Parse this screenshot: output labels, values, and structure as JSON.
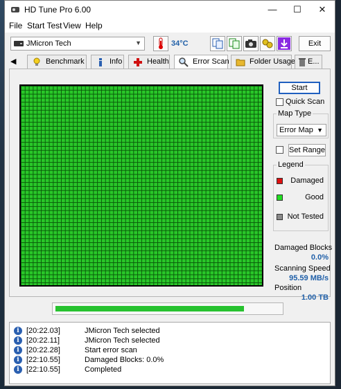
{
  "window": {
    "title": "HD Tune Pro 6.00",
    "controls": {
      "minimize": "—",
      "maximize": "☐",
      "close": "✕"
    }
  },
  "menu": [
    "File",
    "Start Test",
    "View",
    "Help"
  ],
  "toolbar": {
    "drive": "JMicron Tech",
    "temperature": "34°C",
    "exit_label": "Exit",
    "icons": [
      "copy-info-icon",
      "copy-text-icon",
      "screenshot-icon",
      "options-icon",
      "save-icon"
    ]
  },
  "tabs": {
    "scroll_left": "◀",
    "items": [
      {
        "label": "Benchmark",
        "icon": "lightbulb-icon"
      },
      {
        "label": "Info",
        "icon": "info-icon"
      },
      {
        "label": "Health",
        "icon": "health-cross-icon"
      },
      {
        "label": "Error Scan",
        "icon": "magnifier-icon",
        "active": true
      },
      {
        "label": "Folder Usage",
        "icon": "folder-icon"
      },
      {
        "label": "E...",
        "icon": "trash-icon"
      }
    ]
  },
  "error_scan": {
    "start_label": "Start",
    "quick_scan_label": "Quick Scan",
    "quick_scan_checked": false,
    "map_type_title": "Map Type",
    "map_type_value": "Error Map",
    "set_range_label": "Set Range",
    "set_range_checked": false,
    "legend_title": "Legend",
    "legend": [
      {
        "label": "Damaged",
        "color": "#e01010"
      },
      {
        "label": "Good",
        "color": "#22dd22"
      },
      {
        "label": "Not Tested",
        "color": "#8a8a8a"
      }
    ],
    "damaged_blocks_label": "Damaged Blocks",
    "damaged_blocks_value": "0.0%",
    "scanning_speed_label": "Scanning Speed",
    "scanning_speed_value": "95.59 MB/s",
    "position_label": "Position",
    "position_value": "1.00 TB",
    "progress_fraction": 0.84
  },
  "log": [
    {
      "time": "[20:22.03]",
      "message": "JMicron Tech selected"
    },
    {
      "time": "[20:22.11]",
      "message": "JMicron Tech selected"
    },
    {
      "time": "[20:22.28]",
      "message": "Start error scan"
    },
    {
      "time": "[22:10.55]",
      "message": "Damaged Blocks: 0.0%"
    },
    {
      "time": "[22:10.55]",
      "message": "Completed"
    }
  ]
}
